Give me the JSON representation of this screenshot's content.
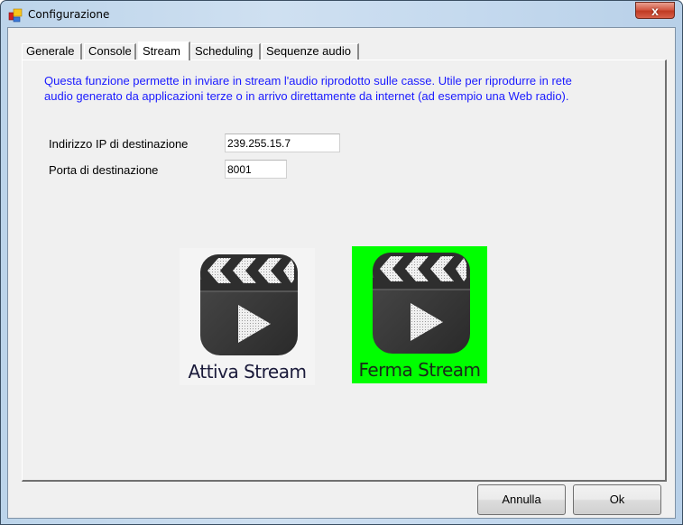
{
  "window": {
    "title": "Configurazione",
    "close_glyph": "x"
  },
  "tabs": [
    {
      "label": "Generale",
      "active": false
    },
    {
      "label": "Console",
      "active": false
    },
    {
      "label": "Stream",
      "active": true
    },
    {
      "label": "Scheduling",
      "active": false
    },
    {
      "label": "Sequenze audio",
      "active": false
    }
  ],
  "stream": {
    "description_line1": "Questa funzione permette in inviare in stream l'audio riprodotto sulle casse. Utile per riprodurre in rete",
    "description_line2": "audio generato da applicazioni terze o in arrivo direttamente da internet (ad esempio una Web radio).",
    "ip_label": "Indirizzo IP di destinazione",
    "ip_value": "239.255.15.7",
    "port_label": "Porta di destinazione",
    "port_value": "8001",
    "start_button": {
      "label": "Attiva Stream",
      "icon": "clapperboard-play-icon",
      "background": "#f4f4f4",
      "text_color": "#1a1a3a"
    },
    "stop_button": {
      "label": "Ferma Stream",
      "icon": "clapperboard-play-icon",
      "background": "#00ff00",
      "text_color": "#1a2a1a"
    }
  },
  "footer": {
    "cancel_label": "Annulla",
    "ok_label": "Ok"
  },
  "colors": {
    "description_text": "#1a1aff",
    "active_stream": "#00ff00"
  }
}
